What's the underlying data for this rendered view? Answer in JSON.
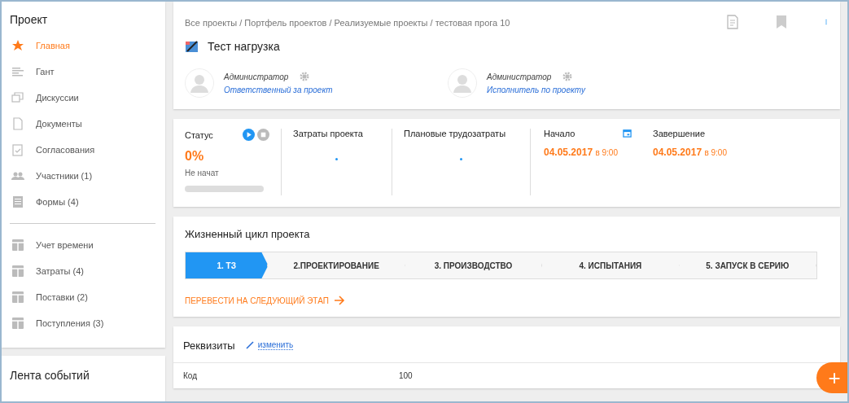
{
  "sidebar": {
    "title": "Проект",
    "items": [
      {
        "label": "Главная",
        "selected": true
      },
      {
        "label": "Гант",
        "selected": false
      },
      {
        "label": "Дискуссии",
        "selected": false
      },
      {
        "label": "Документы",
        "selected": false
      },
      {
        "label": "Согласования",
        "selected": false
      },
      {
        "label": "Участники (1)",
        "selected": false
      },
      {
        "label": "Формы (4)",
        "selected": false
      }
    ],
    "items_2": [
      {
        "label": "Учет времени",
        "selected": false
      },
      {
        "label": "Затраты (4)",
        "selected": false
      },
      {
        "label": "Поставки (2)",
        "selected": false
      },
      {
        "label": "Поступления (3)",
        "selected": false
      }
    ]
  },
  "feed": {
    "title": "Лента событий"
  },
  "header": {
    "breadcrumb": "Все проекты / Портфель проектов / Реализуемые проекты / тестовая прога 10",
    "title": "Тест нагрузка",
    "people": [
      {
        "name": "Администратор",
        "role": "Ответственный за проект"
      },
      {
        "name": "Администратор",
        "role": "Исполнитель по проекту"
      }
    ]
  },
  "summary": {
    "status_label": "Статус",
    "percent": "0%",
    "status": "Не начат",
    "level": 0,
    "costs_label": "Затраты проекта",
    "labor_label": "Плановые трудозатраты",
    "start_label": "Начало",
    "start_date": "04.05.2017",
    "start_time": "в 9:00",
    "end_label": "Завершение",
    "end_date": "04.05.2017",
    "end_time": "в 9:00"
  },
  "lifecycle": {
    "title": "Жизненный цикл проекта",
    "stages": [
      {
        "label": "1. ТЗ",
        "selected": true
      },
      {
        "label": "2.ПРОЕКТИРОВАНИЕ",
        "selected": false
      },
      {
        "label": "3. ПРОИЗВОДСТВО",
        "selected": false
      },
      {
        "label": "4. ИСПЫТАНИЯ",
        "selected": false
      },
      {
        "label": "5. ЗАПУСК В СЕРИЮ",
        "selected": false
      }
    ],
    "next_link": "ПЕРЕВЕСТИ НА СЛЕДУЮЩИЙ ЭТАП"
  },
  "details": {
    "title": "Реквизиты",
    "edit_link": "изменить",
    "rows": [
      {
        "label": "Код",
        "value": "100"
      }
    ]
  },
  "fab": "+"
}
